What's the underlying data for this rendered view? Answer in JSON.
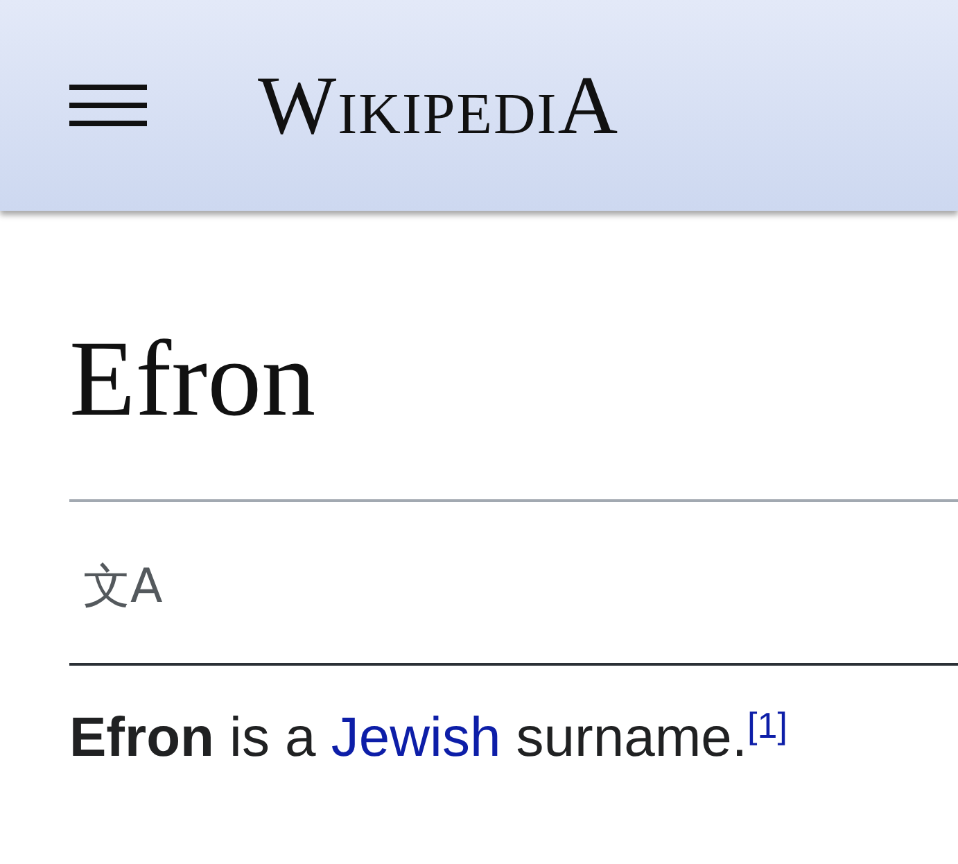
{
  "header": {
    "logo": "WikipediA"
  },
  "article": {
    "title": "Efron",
    "language_icon": "文A",
    "paragraph": [
      {
        "kind": "bold",
        "text": "Efron"
      },
      {
        "kind": "text",
        "text": " is a "
      },
      {
        "kind": "link",
        "text": "Jewish"
      },
      {
        "kind": "text",
        "text": " surname."
      },
      {
        "kind": "citation",
        "text": "[1]"
      }
    ]
  }
}
